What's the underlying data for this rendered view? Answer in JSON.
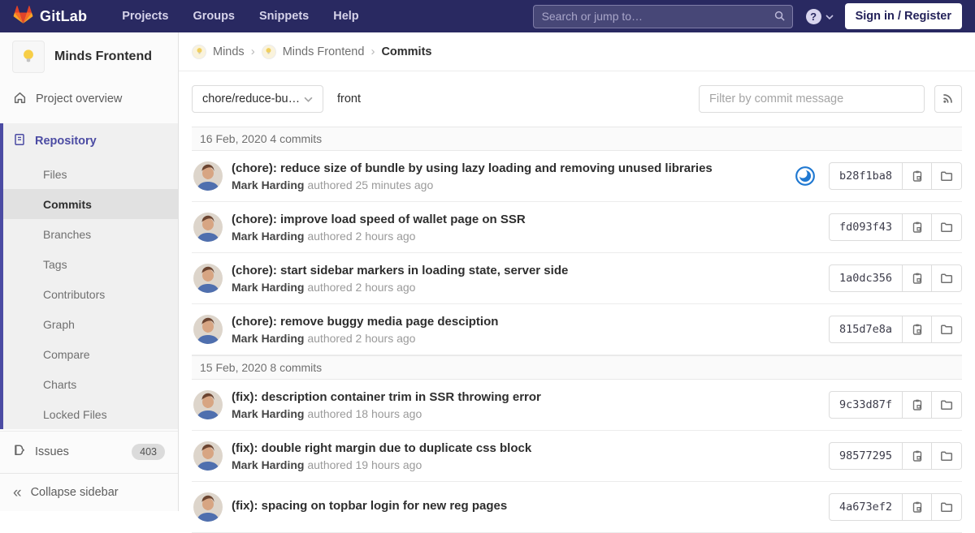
{
  "colors": {
    "navbar_bg": "#292961",
    "accent_indigo": "#4b4ba3",
    "pipeline_running_blue": "#1f78d1",
    "brand_orange": "#fc6d26"
  },
  "navbar": {
    "logo_label": "GitLab",
    "menu_items": [
      "Projects",
      "Groups",
      "Snippets",
      "Help"
    ],
    "search_placeholder": "Search or jump to…",
    "sign_in_label": "Sign in / Register"
  },
  "sidebar": {
    "project_name": "Minds Frontend",
    "project_overview": "Project overview",
    "repository": "Repository",
    "repo_subitems": [
      "Files",
      "Commits",
      "Branches",
      "Tags",
      "Contributors",
      "Graph",
      "Compare",
      "Charts",
      "Locked Files"
    ],
    "issues": "Issues",
    "issues_count": "403",
    "collapse": "Collapse sidebar"
  },
  "breadcrumb": {
    "group": "Minds",
    "project": "Minds Frontend",
    "page": "Commits",
    "separator": "›"
  },
  "controls": {
    "branch_selector": "chore/reduce-bu…",
    "ref_name": "front",
    "filter_placeholder": "Filter by commit message"
  },
  "commits": {
    "groups": [
      {
        "date_label": "16 Feb, 2020 4 commits",
        "items": [
          {
            "title": "(chore): reduce size of bundle by using lazy loading and removing unused libraries",
            "author": "Mark Harding",
            "meta": "authored 25 minutes ago",
            "sha": "b28f1ba8",
            "pipeline_status": "running"
          },
          {
            "title": "(chore): improve load speed of wallet page on SSR",
            "author": "Mark Harding",
            "meta": "authored 2 hours ago",
            "sha": "fd093f43"
          },
          {
            "title": "(chore): start sidebar markers in loading state, server side",
            "author": "Mark Harding",
            "meta": "authored 2 hours ago",
            "sha": "1a0dc356"
          },
          {
            "title": "(chore): remove buggy media page desciption",
            "author": "Mark Harding",
            "meta": "authored 2 hours ago",
            "sha": "815d7e8a"
          }
        ]
      },
      {
        "date_label": "15 Feb, 2020 8 commits",
        "items": [
          {
            "title": "(fix): description container trim in SSR throwing error",
            "author": "Mark Harding",
            "meta": "authored 18 hours ago",
            "sha": "9c33d87f"
          },
          {
            "title": "(fix): double right margin due to duplicate css block",
            "author": "Mark Harding",
            "meta": "authored 19 hours ago",
            "sha": "98577295"
          },
          {
            "title": "(fix): spacing on topbar login for new reg pages",
            "author": "",
            "meta": "",
            "sha": "4a673ef2"
          }
        ]
      }
    ]
  }
}
